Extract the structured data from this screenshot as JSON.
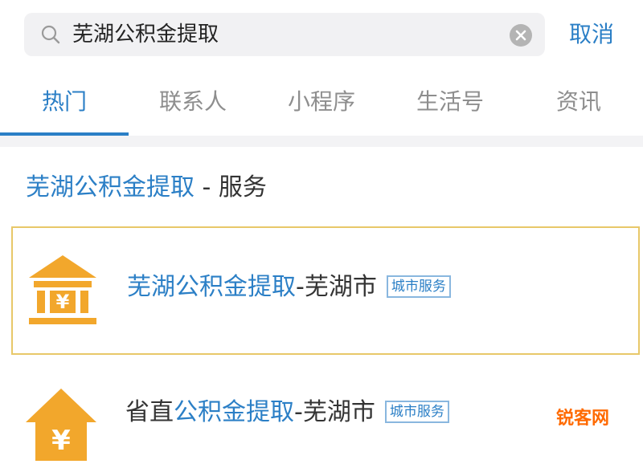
{
  "search": {
    "query": "芜湖公积金提取",
    "cancel_label": "取消"
  },
  "tabs": [
    {
      "label": "热门",
      "active": true
    },
    {
      "label": "联系人",
      "active": false
    },
    {
      "label": "小程序",
      "active": false
    },
    {
      "label": "生活号",
      "active": false
    },
    {
      "label": "资讯",
      "active": false
    }
  ],
  "section": {
    "keyword": "芜湖公积金提取",
    "suffix": " - 服务"
  },
  "results": [
    {
      "title_highlight": "芜湖公积金提取",
      "title_suffix": "-芜湖市",
      "badge": "城市服务",
      "icon": "bank-building-icon"
    },
    {
      "title_prefix": "省直",
      "title_highlight": "公积金提取",
      "title_suffix": "-芜湖市",
      "badge": "城市服务",
      "icon": "house-yuan-icon"
    }
  ],
  "watermark": "锐客网",
  "colors": {
    "accent": "#2b7fc6",
    "icon_orange": "#f2a72c",
    "highlight_border": "#e8c869",
    "muted_text": "#8e8e8e",
    "watermark": "#ff6a00"
  }
}
